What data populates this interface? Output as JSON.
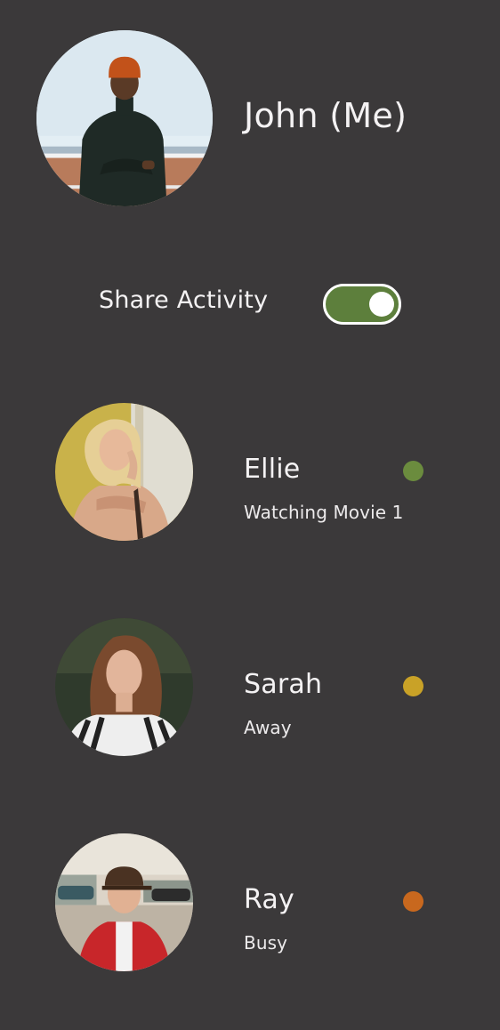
{
  "profile": {
    "name": "John (Me)",
    "avatar": "man-orange-beanie-photo"
  },
  "share_activity": {
    "label": "Share Activity",
    "enabled": true,
    "track_color": "#5d7f3c"
  },
  "friends": [
    {
      "name": "Ellie",
      "status": "Watching Movie 1",
      "status_color": "#6b8c3e",
      "avatar": "blonde-woman-photo"
    },
    {
      "name": "Sarah",
      "status": "Away",
      "status_color": "#c9a227",
      "avatar": "brunette-woman-photo"
    },
    {
      "name": "Ray",
      "status": "Busy",
      "status_color": "#c8681e",
      "avatar": "man-red-jacket-photo"
    }
  ]
}
